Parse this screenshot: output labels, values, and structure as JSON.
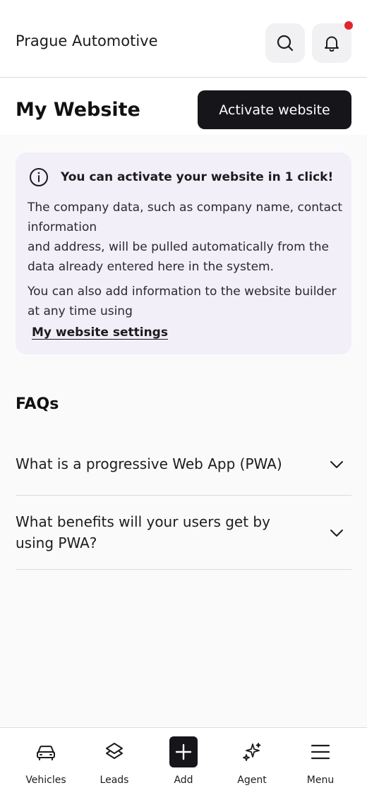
{
  "header": {
    "company_name": "Prague Automotive",
    "search_icon": "search-icon",
    "bell_icon": "bell-icon",
    "notification_dot_color": "#e0262b"
  },
  "page": {
    "title": "My Website",
    "activate_button_label": "Activate website"
  },
  "info_card": {
    "icon": "info-icon",
    "headline": "You can activate your website in 1 click!",
    "paragraph1_line1": "The company data, such as company name, contact information",
    "paragraph1_line2": "and address, will be pulled automatically from the data already entered here in the system.",
    "paragraph2": "You can also add information to the website builder at any time using",
    "settings_link": "My website settings",
    "background": "#f2eff8"
  },
  "faqs": {
    "title": "FAQs",
    "items": [
      {
        "question": "What is a progressive Web App (PWA)",
        "icon": "chevron-down-icon"
      },
      {
        "question": "What benefits will your users get by using PWA?",
        "icon": "chevron-down-icon"
      }
    ]
  },
  "bottom_nav": {
    "items": [
      {
        "label": "Vehicles",
        "icon": "car-icon"
      },
      {
        "label": "Leads",
        "icon": "layers-icon"
      },
      {
        "label": "Add",
        "icon": "plus-icon"
      },
      {
        "label": "Agent",
        "icon": "sparkles-icon"
      },
      {
        "label": "Menu",
        "icon": "hamburger-icon"
      }
    ]
  }
}
